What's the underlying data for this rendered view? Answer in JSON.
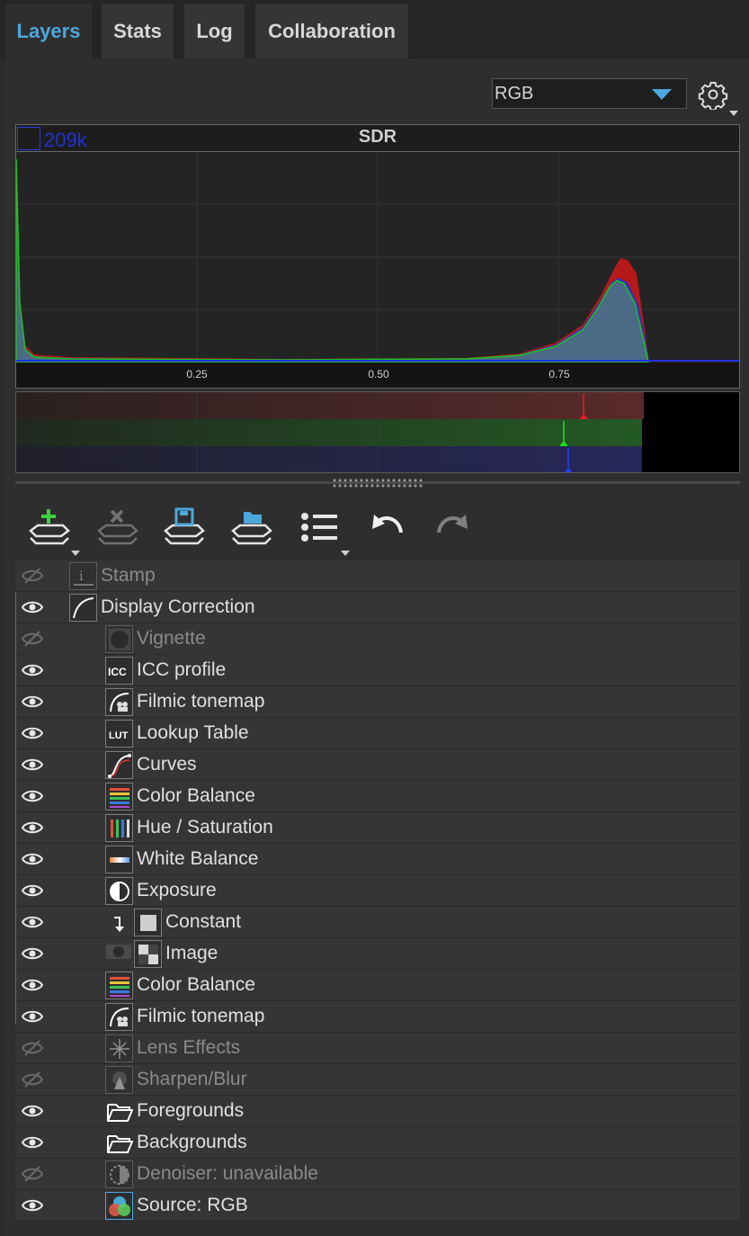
{
  "tabs": [
    {
      "label": "Layers",
      "active": true
    },
    {
      "label": "Stats",
      "active": false
    },
    {
      "label": "Log",
      "active": false
    },
    {
      "label": "Collaboration",
      "active": false
    }
  ],
  "channel_select": {
    "value": "RGB"
  },
  "histogram": {
    "title": "SDR",
    "max_count": "209k",
    "tick_labels": [
      "0.25",
      "0.50",
      "0.75"
    ],
    "series_colors": {
      "red": "#d01818",
      "green": "#18c818",
      "blue": "#2030e8",
      "fill": "#4a6a86"
    }
  },
  "colors": {
    "accent": "#4ba7dd",
    "panel": "#2e2e2e",
    "row": "#353535"
  },
  "toolbar": [
    {
      "name": "add-layer-button",
      "icon": "add-layer-icon",
      "has_menu": true
    },
    {
      "name": "delete-layer-button",
      "icon": "delete-layer-icon",
      "has_menu": false,
      "disabled": true
    },
    {
      "name": "save-layers-button",
      "icon": "save-layers-icon",
      "has_menu": false
    },
    {
      "name": "open-layers-button",
      "icon": "open-layers-icon",
      "has_menu": false
    },
    {
      "name": "layer-list-button",
      "icon": "list-icon",
      "has_menu": true
    },
    {
      "name": "undo-button",
      "icon": "undo-icon",
      "has_menu": false
    },
    {
      "name": "redo-button",
      "icon": "redo-icon",
      "has_menu": false,
      "disabled": true
    }
  ],
  "layers": [
    {
      "label": "Stamp",
      "visible": false,
      "icon": "stamp-icon",
      "depth": 0
    },
    {
      "label": "Display Correction",
      "visible": true,
      "icon": "curve-icon",
      "depth": 0
    },
    {
      "label": "Vignette",
      "visible": false,
      "icon": "vignette-icon",
      "depth": 1
    },
    {
      "label": "ICC profile",
      "visible": true,
      "icon": "icc-icon",
      "depth": 1
    },
    {
      "label": "Filmic tonemap",
      "visible": true,
      "icon": "filmic-icon",
      "depth": 1
    },
    {
      "label": "Lookup Table",
      "visible": true,
      "icon": "lut-icon",
      "depth": 1
    },
    {
      "label": "Curves",
      "visible": true,
      "icon": "curves-icon",
      "depth": 1
    },
    {
      "label": "Color Balance",
      "visible": true,
      "icon": "color-balance-icon",
      "depth": 1
    },
    {
      "label": "Hue / Saturation",
      "visible": true,
      "icon": "hue-saturation-icon",
      "depth": 1
    },
    {
      "label": "White Balance",
      "visible": true,
      "icon": "white-balance-icon",
      "depth": 1
    },
    {
      "label": "Exposure",
      "visible": true,
      "icon": "exposure-icon",
      "depth": 1
    },
    {
      "label": "Constant",
      "visible": true,
      "icon": "constant-icon",
      "depth": 2
    },
    {
      "label": "Image",
      "visible": true,
      "icon": "image-icon",
      "depth": 2
    },
    {
      "label": "Color Balance",
      "visible": true,
      "icon": "color-balance-icon",
      "depth": 1
    },
    {
      "label": "Filmic tonemap",
      "visible": true,
      "icon": "filmic-icon",
      "depth": 1
    },
    {
      "label": "Lens Effects",
      "visible": false,
      "icon": "lens-effects-icon",
      "depth": 1
    },
    {
      "label": "Sharpen/Blur",
      "visible": false,
      "icon": "sharpen-blur-icon",
      "depth": 1
    },
    {
      "label": "Foregrounds",
      "visible": true,
      "icon": "folder-icon",
      "depth": 1
    },
    {
      "label": "Backgrounds",
      "visible": true,
      "icon": "folder-icon",
      "depth": 1
    },
    {
      "label": "Denoiser: unavailable",
      "visible": false,
      "icon": "denoiser-icon",
      "depth": 1
    },
    {
      "label": "Source: RGB",
      "visible": true,
      "icon": "source-rgb-icon",
      "depth": 1
    }
  ]
}
